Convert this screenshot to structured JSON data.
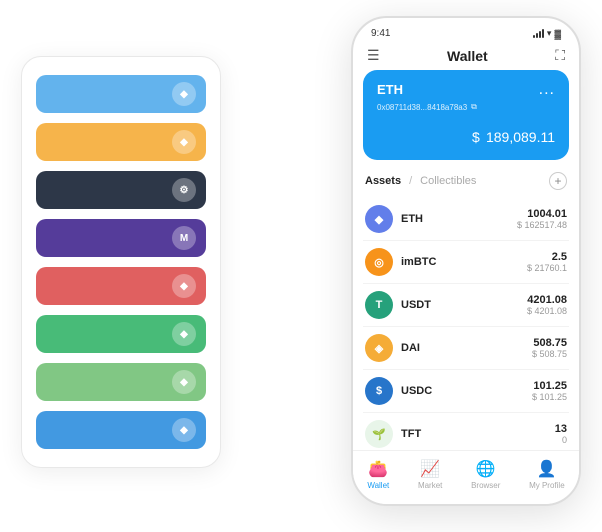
{
  "left_card": {
    "rows": [
      {
        "color": "#63b3ed",
        "icon": "◆",
        "id": "row-blue-1"
      },
      {
        "color": "#f6b44b",
        "icon": "◆",
        "id": "row-orange"
      },
      {
        "color": "#2d3748",
        "icon": "⚙",
        "id": "row-dark"
      },
      {
        "color": "#553c9a",
        "icon": "M",
        "id": "row-purple"
      },
      {
        "color": "#e06060",
        "icon": "◆",
        "id": "row-red"
      },
      {
        "color": "#48bb78",
        "icon": "◆",
        "id": "row-green"
      },
      {
        "color": "#81c784",
        "icon": "◆",
        "id": "row-light-green"
      },
      {
        "color": "#4299e1",
        "icon": "◆",
        "id": "row-blue-2"
      }
    ]
  },
  "phone": {
    "status_bar": {
      "time": "9:41",
      "battery": "▓"
    },
    "header": {
      "menu_icon": "☰",
      "title": "Wallet",
      "expand_icon": "⛶"
    },
    "eth_card": {
      "name": "ETH",
      "address": "0x08711d38...8418a78a3",
      "copy_icon": "⧉",
      "dots": "...",
      "dollar_sign": "$",
      "amount": "189,089.11"
    },
    "assets_tabs": {
      "active": "Assets",
      "divider": "/",
      "inactive": "Collectibles",
      "add_label": "+"
    },
    "assets": [
      {
        "name": "ETH",
        "icon_text": "◆",
        "icon_bg": "#627eea",
        "icon_color": "#fff",
        "amount": "1004.01",
        "usd": "$ 162517.48"
      },
      {
        "name": "imBTC",
        "icon_text": "◎",
        "icon_bg": "#f7931a",
        "icon_color": "#fff",
        "amount": "2.5",
        "usd": "$ 21760.1"
      },
      {
        "name": "USDT",
        "icon_text": "T",
        "icon_bg": "#26a17b",
        "icon_color": "#fff",
        "amount": "4201.08",
        "usd": "$ 4201.08"
      },
      {
        "name": "DAI",
        "icon_text": "◈",
        "icon_bg": "#f5ac37",
        "icon_color": "#fff",
        "amount": "508.75",
        "usd": "$ 508.75"
      },
      {
        "name": "USDC",
        "icon_text": "$",
        "icon_bg": "#2775ca",
        "icon_color": "#fff",
        "amount": "101.25",
        "usd": "$ 101.25"
      },
      {
        "name": "TFT",
        "icon_text": "🌱",
        "icon_bg": "#e8f5e9",
        "icon_color": "#4caf50",
        "amount": "13",
        "usd": "0"
      }
    ],
    "nav": [
      {
        "icon": "👛",
        "label": "Wallet",
        "active": true
      },
      {
        "icon": "📈",
        "label": "Market",
        "active": false
      },
      {
        "icon": "🌐",
        "label": "Browser",
        "active": false
      },
      {
        "icon": "👤",
        "label": "My Profile",
        "active": false
      }
    ]
  }
}
